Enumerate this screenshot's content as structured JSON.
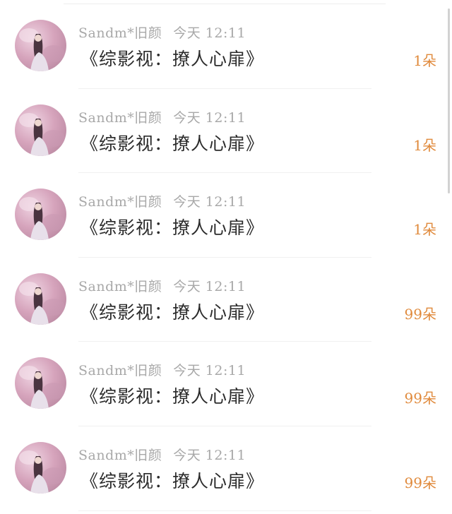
{
  "gifts": [
    {
      "user": "Sandm*旧颜",
      "time": "今天 12:11",
      "book": "《综影视：撩人心扉》",
      "amount": "1朵"
    },
    {
      "user": "Sandm*旧颜",
      "time": "今天 12:11",
      "book": "《综影视：撩人心扉》",
      "amount": "1朵"
    },
    {
      "user": "Sandm*旧颜",
      "time": "今天 12:11",
      "book": "《综影视：撩人心扉》",
      "amount": "1朵"
    },
    {
      "user": "Sandm*旧颜",
      "time": "今天 12:11",
      "book": "《综影视：撩人心扉》",
      "amount": "99朵"
    },
    {
      "user": "Sandm*旧颜",
      "time": "今天 12:11",
      "book": "《综影视：撩人心扉》",
      "amount": "99朵"
    },
    {
      "user": "Sandm*旧颜",
      "time": "今天 12:11",
      "book": "《综影视：撩人心扉》",
      "amount": "99朵"
    }
  ],
  "colors": {
    "amount": "#e08a3c",
    "meta": "#a8a8a8",
    "title": "#2b2b2b"
  }
}
